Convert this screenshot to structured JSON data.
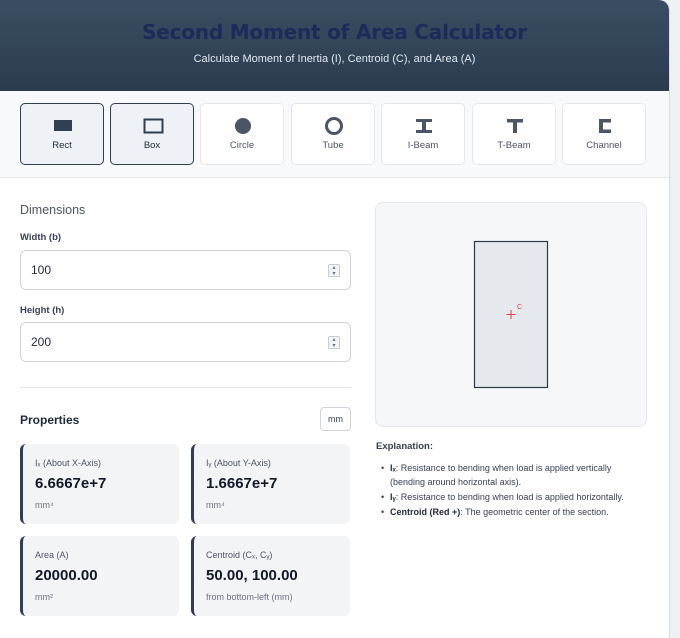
{
  "header": {
    "title": "Second Moment of Area Calculator",
    "subtitle": "Calculate Moment of Inertia (I), Centroid (C), and Area (A)"
  },
  "shapes": [
    {
      "label": "Rect",
      "icon": "filled-rectangle-icon",
      "active": true
    },
    {
      "label": "Box",
      "icon": "hollow-rectangle-icon",
      "active": true
    },
    {
      "label": "Circle",
      "icon": "filled-circle-icon",
      "active": false
    },
    {
      "label": "Tube",
      "icon": "ring-icon",
      "active": false
    },
    {
      "label": "I-Beam",
      "icon": "i-beam-icon",
      "active": false
    },
    {
      "label": "T-Beam",
      "icon": "t-beam-icon",
      "active": false
    },
    {
      "label": "Channel",
      "icon": "channel-icon",
      "active": false
    }
  ],
  "dimensions": {
    "title": "Dimensions",
    "width_label": "Width (b)",
    "width_value": "100",
    "height_label": "Height (h)",
    "height_value": "200"
  },
  "properties": {
    "title": "Properties",
    "unit_button": "mm",
    "cards": {
      "ix": {
        "title": "Iₓ (About X-Axis)",
        "value": "6.6667e+7",
        "unit": "mm⁴"
      },
      "iy": {
        "title": "Iᵧ (About Y-Axis)",
        "value": "1.6667e+7",
        "unit": "mm⁴"
      },
      "area": {
        "title": "Area (A)",
        "value": "20000.00",
        "unit": "mm²"
      },
      "centroid": {
        "title": "Centroid (Cₓ, Cᵧ)",
        "value": "50.00, 100.00",
        "unit": "from bottom-left (mm)"
      }
    }
  },
  "preview": {
    "centroid_label": "C",
    "shape_fill": "#e5e9ee",
    "shape_stroke": "#2d3a4a",
    "centroid_color": "#e53e3e"
  },
  "explanation": {
    "title": "Explanation:",
    "ix_term": "Iₓ",
    "ix_text": ": Resistance to bending when load is applied vertically (bending around horizontal axis).",
    "iy_term": "Iᵧ",
    "iy_text": ": Resistance to bending when load is applied horizontally.",
    "c_term": "Centroid (Red +)",
    "c_text": ": The geometric center of the section."
  },
  "colors": {
    "header_bg": "#2f4052",
    "title": "#1b2c5a",
    "accent": "#2f3e50"
  }
}
